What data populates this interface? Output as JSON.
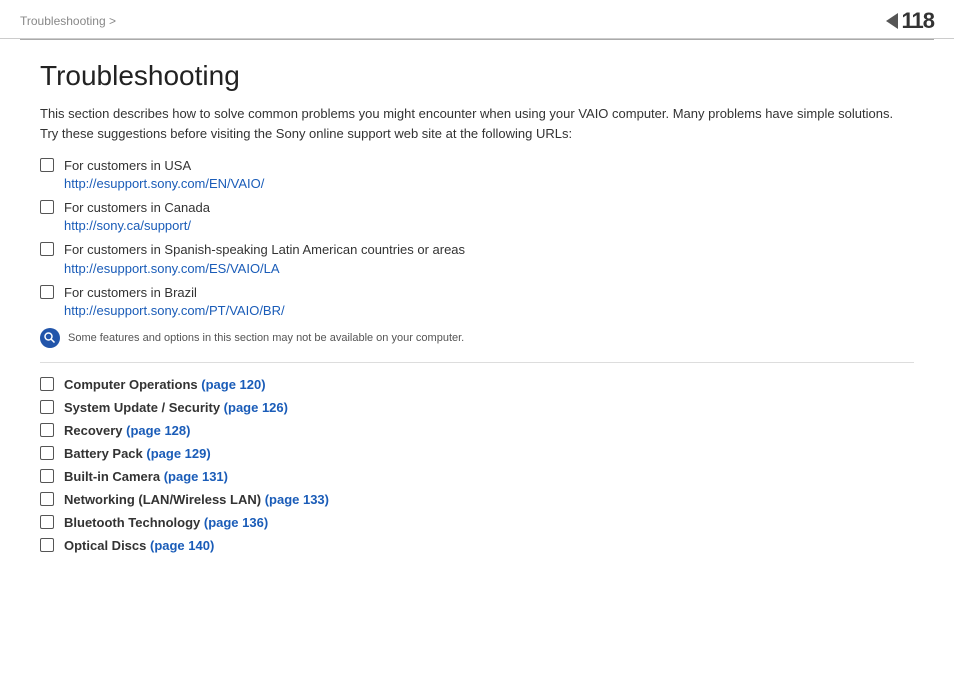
{
  "header": {
    "breadcrumb": "Troubleshooting >",
    "page_number": "118",
    "arrow_symbol": "◄"
  },
  "page": {
    "title": "Troubleshooting",
    "intro": "This section describes how to solve common problems you might encounter when using your VAIO computer. Many problems have simple solutions. Try these suggestions before visiting the Sony online support web site at the following URLs:",
    "note_text": "Some features and options in this section may not be available on your computer."
  },
  "url_items": [
    {
      "label": "For customers in USA",
      "url": "http://esupport.sony.com/EN/VAIO/"
    },
    {
      "label": "For customers in Canada",
      "url": "http://sony.ca/support/"
    },
    {
      "label": "For customers in Spanish-speaking Latin American countries or areas",
      "url": "http://esupport.sony.com/ES/VAIO/LA"
    },
    {
      "label": "For customers in Brazil",
      "url": "http://esupport.sony.com/PT/VAIO/BR/"
    }
  ],
  "nav_items": [
    {
      "label": "Computer Operations",
      "link_text": "(page 120)",
      "page": "120"
    },
    {
      "label": "System Update / Security",
      "link_text": "(page 126)",
      "page": "126"
    },
    {
      "label": "Recovery",
      "link_text": "(page 128)",
      "page": "128"
    },
    {
      "label": "Battery Pack",
      "link_text": "(page 129)",
      "page": "129"
    },
    {
      "label": "Built-in Camera",
      "link_text": "(page 131)",
      "page": "131"
    },
    {
      "label": "Networking (LAN/Wireless LAN)",
      "link_text": "(page 133)",
      "page": "133"
    },
    {
      "label": "Bluetooth Technology",
      "link_text": "(page 136)",
      "page": "136"
    },
    {
      "label": "Optical Discs",
      "link_text": "(page 140)",
      "page": "140"
    }
  ]
}
